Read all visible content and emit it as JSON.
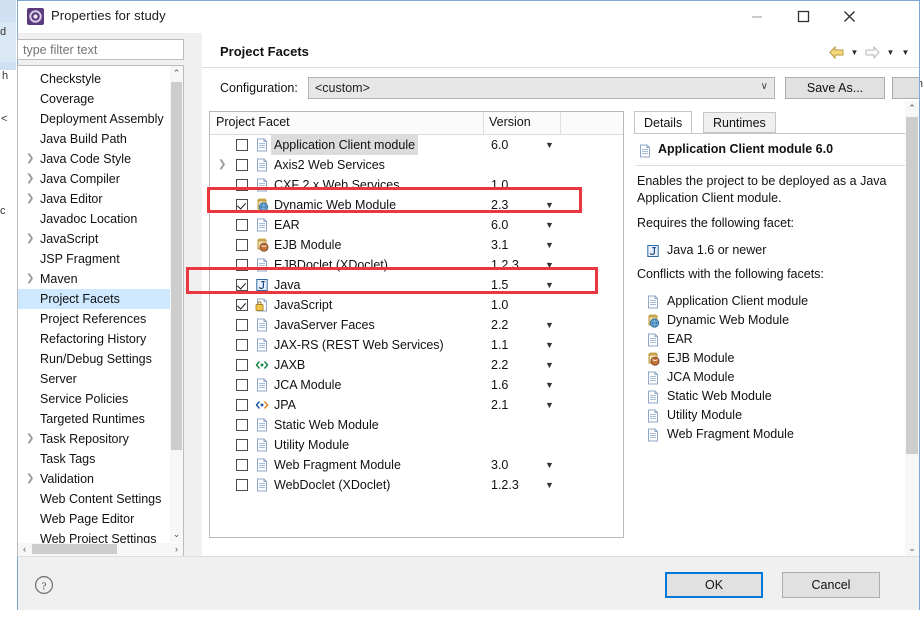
{
  "window": {
    "title": "Properties for study",
    "icon": "eclipse-properties-icon",
    "minimize_label": "—",
    "maximize_label": "□",
    "close_label": "✕"
  },
  "sidebar": {
    "filter_placeholder": "type filter text",
    "filter_value": "",
    "items": [
      {
        "label": "Checkstyle",
        "expandable": false,
        "selected": false
      },
      {
        "label": "Coverage",
        "expandable": false,
        "selected": false
      },
      {
        "label": "Deployment Assembly",
        "expandable": false,
        "selected": false
      },
      {
        "label": "Java Build Path",
        "expandable": false,
        "selected": false
      },
      {
        "label": "Java Code Style",
        "expandable": true,
        "selected": false
      },
      {
        "label": "Java Compiler",
        "expandable": true,
        "selected": false
      },
      {
        "label": "Java Editor",
        "expandable": true,
        "selected": false
      },
      {
        "label": "Javadoc Location",
        "expandable": false,
        "selected": false
      },
      {
        "label": "JavaScript",
        "expandable": true,
        "selected": false
      },
      {
        "label": "JSP Fragment",
        "expandable": false,
        "selected": false
      },
      {
        "label": "Maven",
        "expandable": true,
        "selected": false
      },
      {
        "label": "Project Facets",
        "expandable": false,
        "selected": true
      },
      {
        "label": "Project References",
        "expandable": false,
        "selected": false
      },
      {
        "label": "Refactoring History",
        "expandable": false,
        "selected": false
      },
      {
        "label": "Run/Debug Settings",
        "expandable": false,
        "selected": false
      },
      {
        "label": "Server",
        "expandable": false,
        "selected": false
      },
      {
        "label": "Service Policies",
        "expandable": false,
        "selected": false
      },
      {
        "label": "Targeted Runtimes",
        "expandable": false,
        "selected": false
      },
      {
        "label": "Task Repository",
        "expandable": true,
        "selected": false
      },
      {
        "label": "Task Tags",
        "expandable": false,
        "selected": false
      },
      {
        "label": "Validation",
        "expandable": true,
        "selected": false
      },
      {
        "label": "Web Content Settings",
        "expandable": false,
        "selected": false
      },
      {
        "label": "Web Page Editor",
        "expandable": false,
        "selected": false
      },
      {
        "label": "Web Project Settings",
        "expandable": false,
        "selected": false
      }
    ]
  },
  "page": {
    "title": "Project Facets",
    "nav_back_icon": "back-arrow-icon",
    "nav_forward_icon": "forward-arrow-icon",
    "caret_icon": "▼"
  },
  "configuration": {
    "label": "Configuration:",
    "value": "<custom>",
    "dropdown_icon": "∨",
    "save_as_label": "Save As..."
  },
  "facets_table": {
    "columns": [
      "Project Facet",
      "Version"
    ],
    "rows": [
      {
        "name": "Application Client module",
        "version": "6.0",
        "checked": false,
        "expandable": false,
        "has_caret": true,
        "icon": "document-icon",
        "highlighted": true
      },
      {
        "name": "Axis2 Web Services",
        "version": "",
        "checked": false,
        "expandable": true,
        "has_caret": false,
        "icon": "document-icon",
        "highlighted": false
      },
      {
        "name": "CXF 2.x Web Services",
        "version": "1.0",
        "checked": false,
        "expandable": false,
        "has_caret": false,
        "icon": "document-icon",
        "highlighted": false
      },
      {
        "name": "Dynamic Web Module",
        "version": "2.3",
        "checked": true,
        "expandable": false,
        "has_caret": true,
        "icon": "web-module-icon",
        "highlighted": false
      },
      {
        "name": "EAR",
        "version": "6.0",
        "checked": false,
        "expandable": false,
        "has_caret": true,
        "icon": "document-icon",
        "highlighted": false
      },
      {
        "name": "EJB Module",
        "version": "3.1",
        "checked": false,
        "expandable": false,
        "has_caret": true,
        "icon": "ejb-module-icon",
        "highlighted": false
      },
      {
        "name": "EJBDoclet (XDoclet)",
        "version": "1.2.3",
        "checked": false,
        "expandable": false,
        "has_caret": true,
        "icon": "document-icon",
        "highlighted": false
      },
      {
        "name": "Java",
        "version": "1.5",
        "checked": true,
        "expandable": false,
        "has_caret": true,
        "icon": "java-icon",
        "highlighted": false
      },
      {
        "name": "JavaScript",
        "version": "1.0",
        "checked": true,
        "expandable": false,
        "has_caret": false,
        "icon": "javascript-icon",
        "highlighted": false
      },
      {
        "name": "JavaServer Faces",
        "version": "2.2",
        "checked": false,
        "expandable": false,
        "has_caret": true,
        "icon": "document-icon",
        "highlighted": false
      },
      {
        "name": "JAX-RS (REST Web Services)",
        "version": "1.1",
        "checked": false,
        "expandable": false,
        "has_caret": true,
        "icon": "document-icon",
        "highlighted": false
      },
      {
        "name": "JAXB",
        "version": "2.2",
        "checked": false,
        "expandable": false,
        "has_caret": true,
        "icon": "jaxb-icon",
        "highlighted": false
      },
      {
        "name": "JCA Module",
        "version": "1.6",
        "checked": false,
        "expandable": false,
        "has_caret": true,
        "icon": "document-icon",
        "highlighted": false
      },
      {
        "name": "JPA",
        "version": "2.1",
        "checked": false,
        "expandable": false,
        "has_caret": true,
        "icon": "jpa-icon",
        "highlighted": false
      },
      {
        "name": "Static Web Module",
        "version": "",
        "checked": false,
        "expandable": false,
        "has_caret": false,
        "icon": "document-icon",
        "highlighted": false
      },
      {
        "name": "Utility Module",
        "version": "",
        "checked": false,
        "expandable": false,
        "has_caret": false,
        "icon": "document-icon",
        "highlighted": false
      },
      {
        "name": "Web Fragment Module",
        "version": "3.0",
        "checked": false,
        "expandable": false,
        "has_caret": true,
        "icon": "document-icon",
        "highlighted": false
      },
      {
        "name": "WebDoclet (XDoclet)",
        "version": "1.2.3",
        "checked": false,
        "expandable": false,
        "has_caret": true,
        "icon": "document-icon",
        "highlighted": false
      }
    ]
  },
  "details": {
    "tabs": [
      {
        "label": "Details",
        "active": true
      },
      {
        "label": "Runtimes",
        "active": false
      }
    ],
    "heading": "Application Client module 6.0",
    "heading_icon": "document-icon",
    "description": "Enables the project to be deployed as a Java Application Client module.",
    "requires_label": "Requires the following facet:",
    "requires": [
      {
        "label": "Java 1.6 or newer",
        "icon": "java-icon"
      }
    ],
    "conflicts_label": "Conflicts with the following facets:",
    "conflicts": [
      {
        "label": "Application Client module",
        "icon": "document-icon"
      },
      {
        "label": "Dynamic Web Module",
        "icon": "web-module-icon"
      },
      {
        "label": "EAR",
        "icon": "document-icon"
      },
      {
        "label": "EJB Module",
        "icon": "ejb-module-icon"
      },
      {
        "label": "JCA Module",
        "icon": "document-icon"
      },
      {
        "label": "Static Web Module",
        "icon": "document-icon"
      },
      {
        "label": "Utility Module",
        "icon": "document-icon"
      },
      {
        "label": "Web Fragment Module",
        "icon": "document-icon"
      }
    ]
  },
  "footer": {
    "help_icon": "help-icon",
    "ok_label": "OK",
    "cancel_label": "Cancel"
  },
  "annotations": {
    "highlight_color": "#e8383d",
    "boxes": [
      "dynamic-web-module-row",
      "java-row"
    ]
  },
  "scrollbars": {
    "up_glyph": "⌃",
    "down_glyph": "⌄",
    "left_glyph": "‹",
    "right_glyph": "›"
  }
}
